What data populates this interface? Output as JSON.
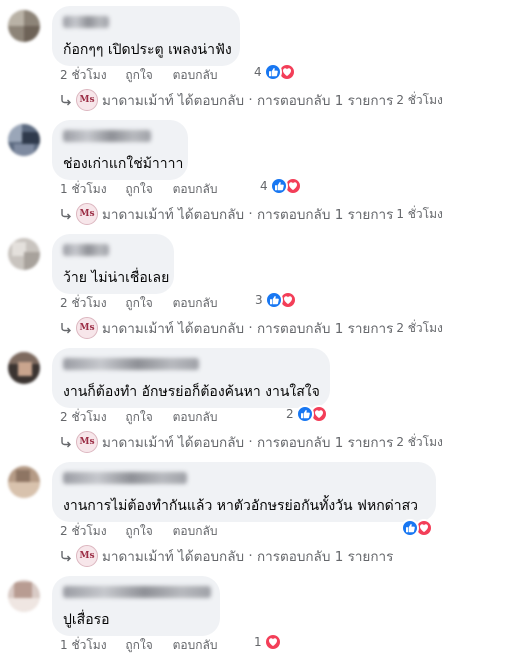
{
  "actions": {
    "like": "ถูกใจ",
    "reply": "ตอบกลับ"
  },
  "replier": {
    "name": "มาดามเม้าท์",
    "logo_text": "Ms"
  },
  "reply_summary": {
    "verb": "ได้ตอบกลับ",
    "separator": "·",
    "count_text": "การตอบกลับ 1 รายการ"
  },
  "colors": {
    "like": "#1877f2",
    "love": "#f33e58",
    "bubble": "#f0f2f5",
    "meta": "#65676b"
  },
  "comments": [
    {
      "text": "ก้อกๆๆ เปิดประตู เพลงน่าฟัง",
      "time": "2 ชั่วโมง",
      "reaction_count": "4",
      "reactions": [
        "like-icon",
        "love-icon"
      ],
      "reply_time": "2 ชั่วโมง"
    },
    {
      "text": "ช่องเก่าแกใช่ม้าาาา",
      "time": "1 ชั่วโมง",
      "reaction_count": "4",
      "reactions": [
        "like-icon",
        "love-icon"
      ],
      "reply_time": "1 ชั่วโมง"
    },
    {
      "text": "ว้าย ไม่น่าเชื่อเลย",
      "time": "2 ชั่วโมง",
      "reaction_count": "3",
      "reactions": [
        "like-icon",
        "love-icon"
      ],
      "reply_time": "2 ชั่วโมง"
    },
    {
      "text": "งานก็ต้องทำ อักษรย่อก็ต้องค้นหา งานใสใจ",
      "time": "2 ชั่วโมง",
      "reaction_count": "2",
      "reactions": [
        "like-icon",
        "love-icon"
      ],
      "reply_time": "2 ชั่วโมง"
    },
    {
      "text": "งานการไม่ต้องทำกันแล้ว หาตัวอักษรย่อกันทั้งวัน ฟหกด่าสว",
      "time": "2 ชั่วโมง",
      "reaction_count": "",
      "reactions": [
        "like-icon",
        "love-icon"
      ],
      "reply_time": ""
    },
    {
      "text": "ปูเสื่อรอ",
      "time": "1 ชั่วโมง",
      "reaction_count": "1",
      "reactions": [
        "love-icon"
      ],
      "reply_time": ""
    }
  ]
}
